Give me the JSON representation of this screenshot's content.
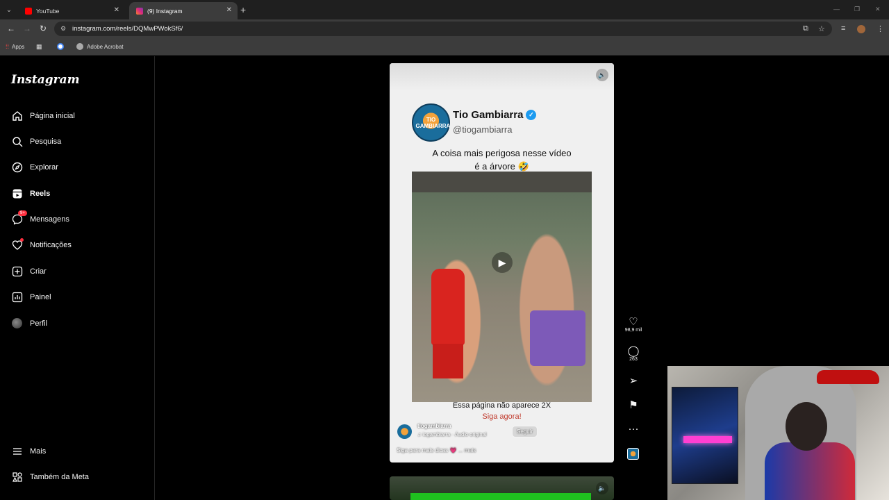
{
  "browser": {
    "tabs": [
      {
        "title": "YouTube",
        "favicon_color": "#ff0000"
      },
      {
        "title": "(9) Instagram",
        "favicon_color": "#e1306c"
      }
    ],
    "url": "instagram.com/reels/DQMwPWokSf6/",
    "bookmarks": [
      {
        "label": "Apps"
      },
      {
        "label": "Adobe Acrobat"
      }
    ]
  },
  "instagram": {
    "logo": "Instagram",
    "nav": [
      {
        "label": "Página inicial",
        "icon": "home-icon"
      },
      {
        "label": "Pesquisa",
        "icon": "search-icon"
      },
      {
        "label": "Explorar",
        "icon": "compass-icon"
      },
      {
        "label": "Reels",
        "icon": "reels-icon"
      },
      {
        "label": "Mensagens",
        "icon": "messenger-icon",
        "badge": "9+"
      },
      {
        "label": "Notificações",
        "icon": "heart-icon"
      },
      {
        "label": "Criar",
        "icon": "plus-square-icon"
      },
      {
        "label": "Painel",
        "icon": "dashboard-icon"
      },
      {
        "label": "Perfil",
        "icon": "profile-avatar"
      }
    ],
    "bottom_nav": [
      {
        "label": "Mais",
        "icon": "menu-icon"
      },
      {
        "label": "Também da Meta",
        "icon": "meta-icon"
      }
    ]
  },
  "reel": {
    "channel_avatar_text": "TIO GAMBIARRA",
    "channel_name": "Tio Gambiarra",
    "channel_handle": "@tiogambiarra",
    "caption_line1": "A coisa mais perigosa nesse vídeo",
    "caption_line2": "é a árvore 🤣",
    "video_text_1": "Essa página não aparece 2X",
    "video_text_2": "Siga agora!",
    "owner": "tiogambiarra",
    "audio": "♫ iogambiarra · Áudio original",
    "follow_label": "Seguir",
    "post_caption": "Siga para mais dicas 💗",
    "more_label": "... mais",
    "likes": "98,9 mil",
    "comments": "263"
  }
}
